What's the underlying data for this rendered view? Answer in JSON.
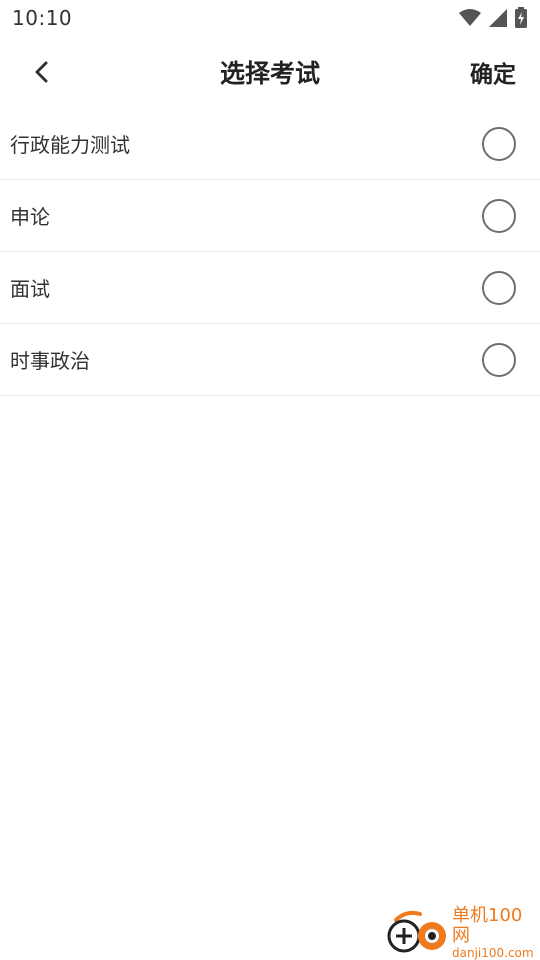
{
  "status_bar": {
    "time": "10:10",
    "icons": [
      "wifi-icon",
      "signal-icon",
      "battery-charging-icon"
    ]
  },
  "header": {
    "back_icon": "chevron-left-icon",
    "title": "选择考试",
    "confirm_label": "确定"
  },
  "options": [
    {
      "label": "行政能力测试",
      "selected": false
    },
    {
      "label": "申论",
      "selected": false
    },
    {
      "label": "面试",
      "selected": false
    },
    {
      "label": "时事政治",
      "selected": false
    }
  ],
  "watermark": {
    "name": "单机100网",
    "url": "danji100.com",
    "color": "#f07b1e"
  }
}
